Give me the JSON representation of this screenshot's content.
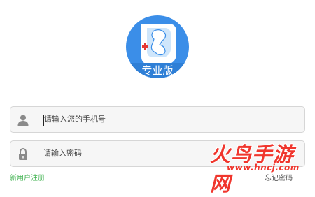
{
  "logo": {
    "badge_text": "专业版",
    "brand_color": "#3b8ee8",
    "light_color": "#cfe6fb",
    "accent_color": "#e53935"
  },
  "login": {
    "phone_placeholder": "请输入您的手机号",
    "password_placeholder": "请输入密码",
    "phone_icon": "user-icon",
    "password_icon": "lock-icon"
  },
  "footer": {
    "left_link": "新用户注册",
    "right_link": "忘记密码"
  },
  "watermark": {
    "brand": "火鸟手游网",
    "url": "www.hncj.com"
  }
}
